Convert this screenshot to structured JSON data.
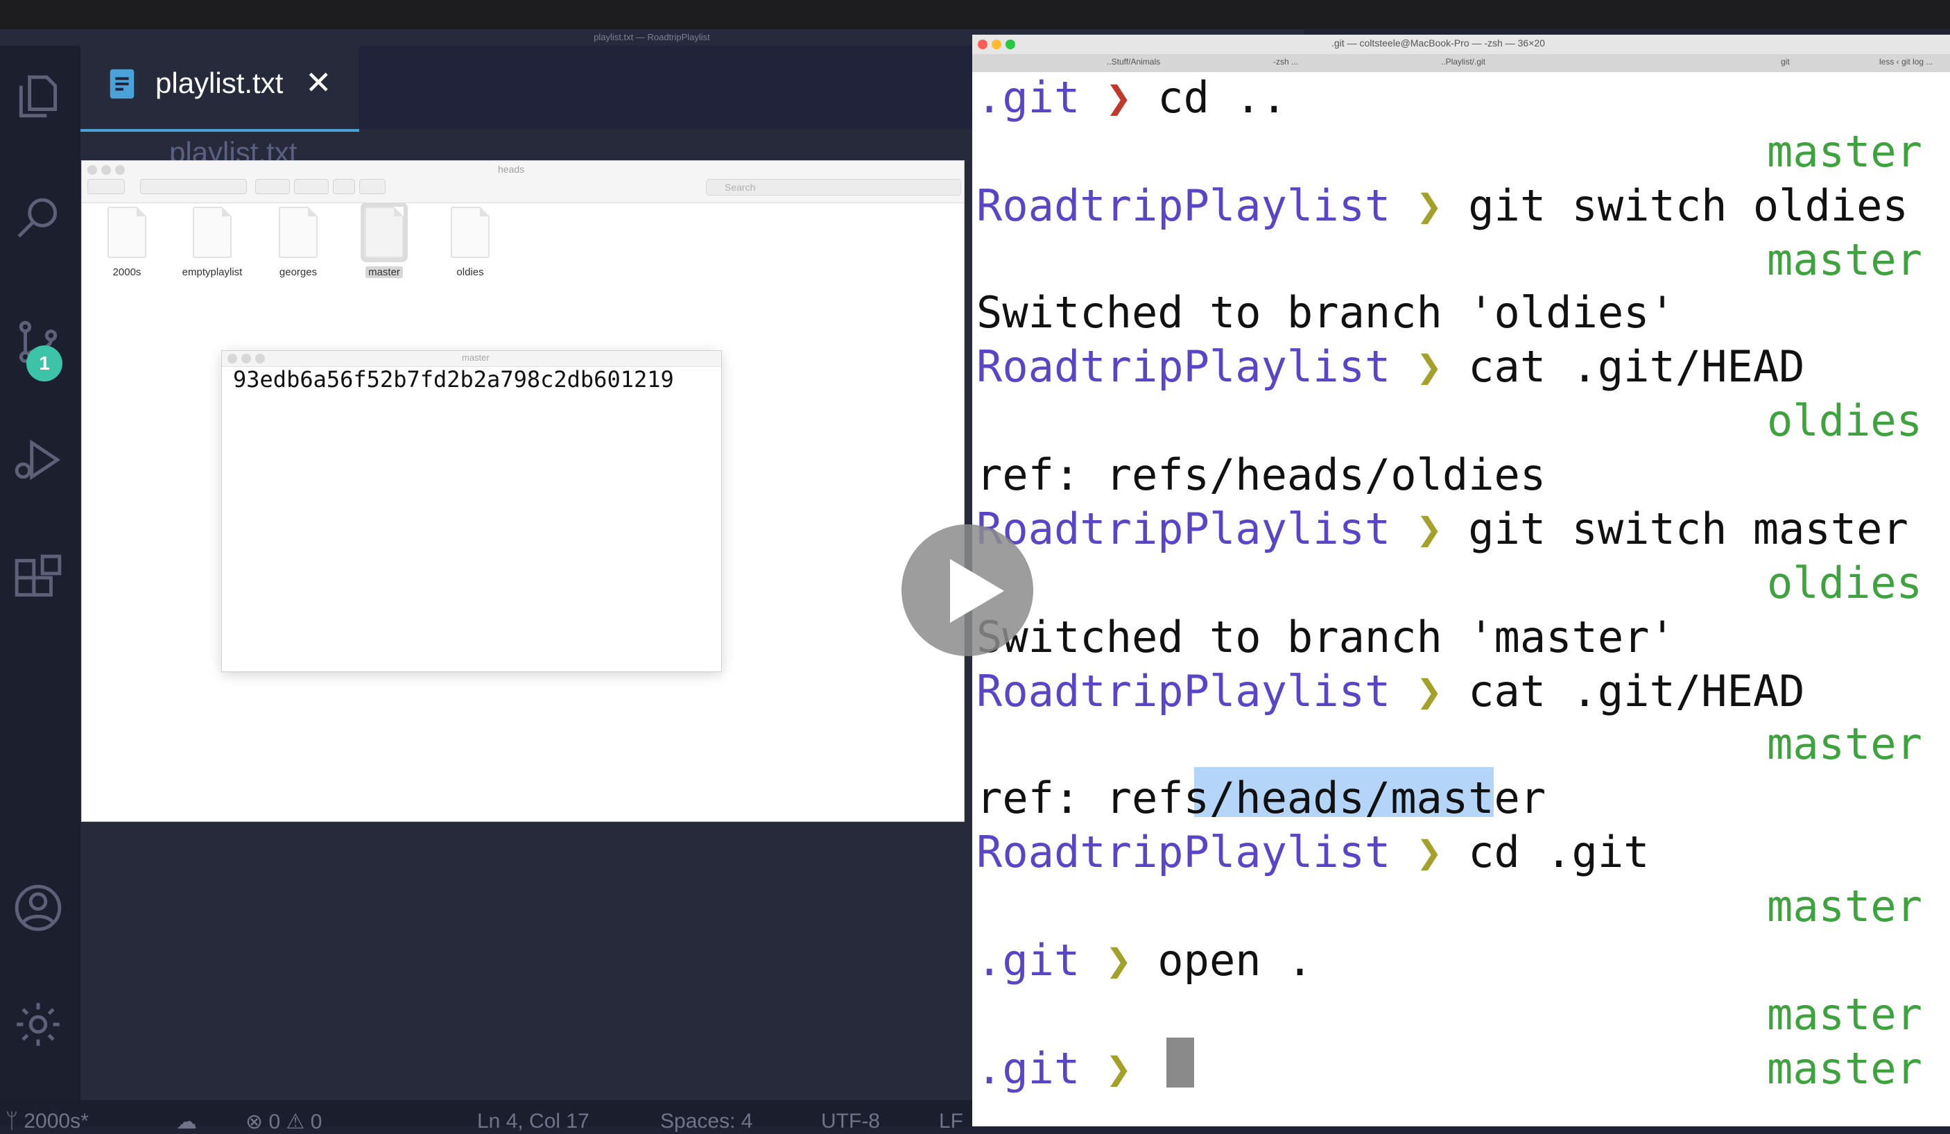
{
  "vscode": {
    "window_title": "playlist.txt — RoadtripPlaylist",
    "tab_label": "playlist.txt",
    "tab_close": "✕",
    "second_tab_label": "playlist.txt",
    "scm_badge": "1",
    "statusbar": {
      "branch": "2000s*",
      "problems": "0",
      "warnings": "0",
      "position": "Ln 4, Col 17",
      "spaces": "Spaces: 4",
      "encoding": "UTF-8",
      "eol": "LF"
    }
  },
  "finder": {
    "title": "heads",
    "search_placeholder": "Search",
    "files": [
      "2000s",
      "emptyplaylist",
      "georges",
      "master",
      "oldies"
    ],
    "selected_file": "master"
  },
  "textedit": {
    "title": "master",
    "content": "93edb6a56f52b7fd2b2a798c2db601219"
  },
  "terminal": {
    "title": ".git — coltsteele@MacBook-Pro — -zsh — 36×20",
    "tabs": [
      "..Stuff/Animals",
      "-zsh ...",
      "..Playlist/.git",
      "git",
      "less ‹ git log ..."
    ],
    "arrow": "❯",
    "lines": [
      {
        "dir": ".git",
        "cmd": " cd .."
      },
      {
        "right": "master"
      },
      {
        "dir": "RoadtripPlaylist",
        "cmd": " git switch oldies"
      },
      {
        "right": "master"
      },
      {
        "out": "Switched to branch 'oldies'"
      },
      {
        "dir": "RoadtripPlaylist",
        "cmd": " cat .git/HEAD"
      },
      {
        "right": "oldies"
      },
      {
        "out": "ref: refs/heads/oldies"
      },
      {
        "dir": "RoadtripPlaylist",
        "cmd": " git switch master"
      },
      {
        "right": "oldies"
      },
      {
        "out": "Switched to branch 'master'"
      },
      {
        "dir": "RoadtripPlaylist",
        "cmd": " cat .git/HEAD"
      },
      {
        "right": "master"
      },
      {
        "out": "ref: refs/heads/master"
      },
      {
        "dir": "RoadtripPlaylist",
        "cmd": " cd .git"
      },
      {
        "right": "master"
      },
      {
        "dir": ".git",
        "cmd": " open ."
      },
      {
        "right": "master"
      },
      {
        "dir": ".git",
        "cmd": "",
        "right": "master"
      }
    ]
  }
}
